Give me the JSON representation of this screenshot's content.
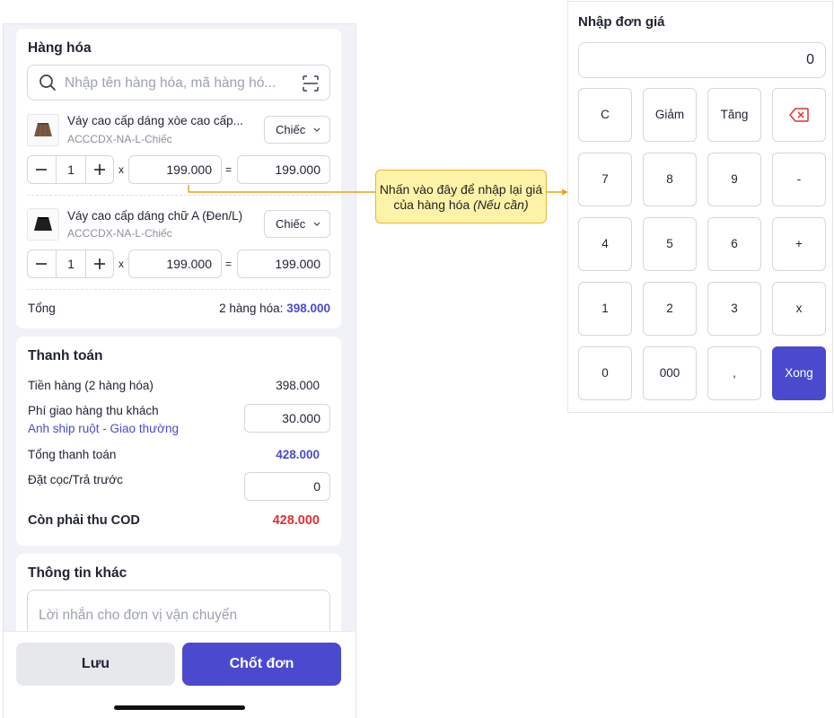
{
  "order": {
    "goods_title": "Hàng hóa",
    "search_placeholder": "Nhập tên hàng hóa, mã hàng hó...",
    "items": [
      {
        "name": "Váy cao cấp dáng xòe cao cấp...",
        "sku": "ACCCDX-NA-L-Chiếc",
        "unit": "Chiếc",
        "qty": "1",
        "price": "199.000",
        "total": "199.000"
      },
      {
        "name": "Váy cao cấp dáng chữ A (Đen/L)",
        "sku": "ACCCDX-NA-L-Chiếc",
        "unit": "Chiếc",
        "qty": "1",
        "price": "199.000",
        "total": "199.000"
      }
    ],
    "op_times": "x",
    "op_equals": "=",
    "total_label": "Tổng",
    "total_count": "2 hàng hóa: ",
    "total_value": "398.000"
  },
  "payment": {
    "title": "Thanh toán",
    "subtotal_label": "Tiền hàng (2 hàng hóa)",
    "subtotal_value": "398.000",
    "shipping_label": "Phí giao hàng thu khách",
    "shipping_value": "30.000",
    "shipping_link": "Anh ship ruột - Giao thường",
    "grand_label": "Tổng thanh toán",
    "grand_value": "428.000",
    "deposit_label": "Đặt cọc/Trả trước",
    "deposit_value": "0",
    "cod_label": "Còn phải thu COD",
    "cod_value": "428.000"
  },
  "other": {
    "title": "Thông tin khác",
    "note_placeholder": "Lời nhắn cho đơn vị vận chuyển"
  },
  "actions": {
    "save": "Lưu",
    "close_order": "Chốt đơn"
  },
  "callout": {
    "line1": "Nhấn vào đây để nhập lại giá",
    "line2": "của hàng hóa ",
    "line2_italic": "(Nếu cần)"
  },
  "keypad": {
    "title": "Nhập đơn giá",
    "display": "0",
    "keys": [
      "C",
      "Giảm",
      "Tăng",
      "7",
      "8",
      "9",
      "-",
      "4",
      "5",
      "6",
      "+",
      "1",
      "2",
      "3",
      "x",
      "0",
      "000",
      ",",
      "Xong"
    ]
  },
  "colors": {
    "accent": "#4b4acf",
    "danger": "#e03131",
    "callout_bg": "#fdf3a8",
    "callout_line": "#e8a317"
  }
}
